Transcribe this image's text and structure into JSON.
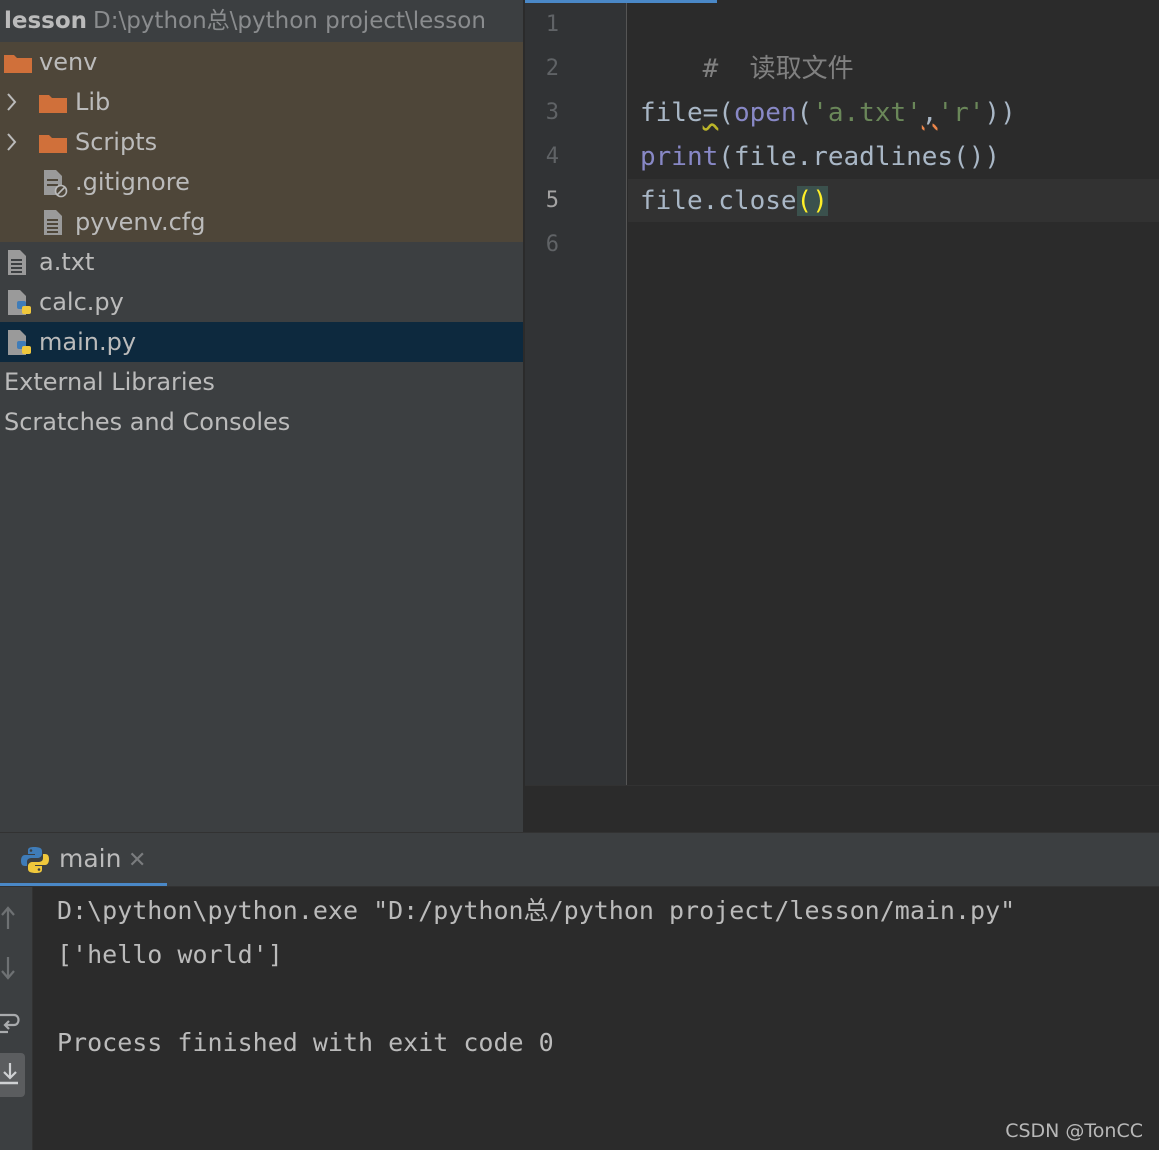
{
  "project": {
    "root_name": "lesson",
    "root_path": "D:\\python总\\python project\\lesson",
    "items": [
      {
        "label": "venv",
        "type": "folder",
        "expanded": true
      },
      {
        "label": "Lib",
        "type": "folder",
        "expanded": false
      },
      {
        "label": "Scripts",
        "type": "folder",
        "expanded": false
      },
      {
        "label": ".gitignore",
        "type": "ignored-file"
      },
      {
        "label": "pyvenv.cfg",
        "type": "text-file"
      },
      {
        "label": "a.txt",
        "type": "text-file"
      },
      {
        "label": "calc.py",
        "type": "python-file"
      },
      {
        "label": "main.py",
        "type": "python-file",
        "selected": true
      },
      {
        "label": "External Libraries",
        "type": "node"
      },
      {
        "label": "Scratches and Consoles",
        "type": "node"
      }
    ]
  },
  "editor": {
    "line_numbers": [
      "1",
      "2",
      "3",
      "4",
      "5",
      "6"
    ],
    "current_line": "5",
    "code": {
      "l1": "#  读取文件",
      "l3": {
        "var": "file",
        "eq": "=",
        "p1": "(",
        "fn": "open",
        "p2": "(",
        "s1": "'a.txt'",
        "comma": ",",
        "s2": "'r'",
        "p3": "))"
      },
      "l4": {
        "fn": "print",
        "rest": "(file.readlines())"
      },
      "l5": {
        "text": "file.close",
        "braces": "()"
      }
    }
  },
  "run": {
    "tab_label": "main",
    "console_lines": [
      "D:\\python\\python.exe \"D:/python总/python project/lesson/main.py\"",
      "['hello world']",
      "",
      "Process finished with exit code 0"
    ]
  },
  "watermark": "CSDN @TonCC",
  "colors": {
    "folder": "#d0703a",
    "selection": "#0d293e",
    "excluded_bg": "#4e4639",
    "accent": "#4a88c7",
    "string": "#6a8759",
    "builtin": "#8888c6"
  }
}
